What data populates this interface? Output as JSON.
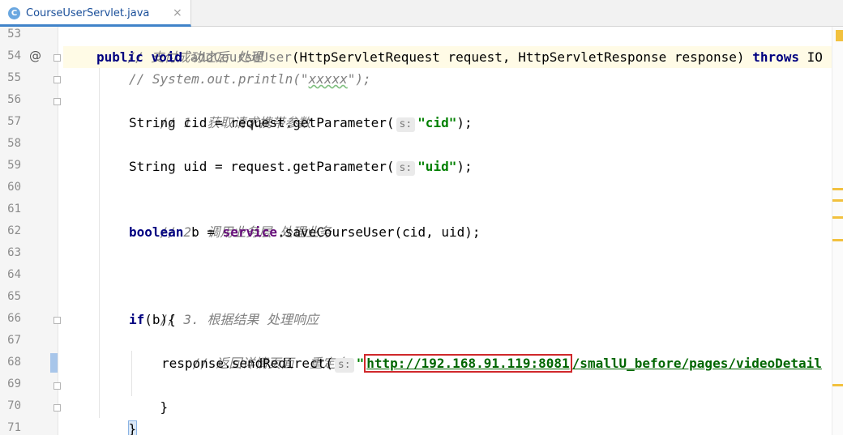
{
  "tab": {
    "icon_letter": "C",
    "file_name": "CourseUserServlet.java",
    "close_glyph": "×"
  },
  "gutter": {
    "line_numbers": [
      "53",
      "54",
      "55",
      "56",
      "57",
      "58",
      "59",
      "60",
      "61",
      "62",
      "63",
      "64",
      "65",
      "66",
      "67",
      "68",
      "69",
      "70",
      "71"
    ],
    "annotation_line_54": "@"
  },
  "code": {
    "l53": {
      "comment": "// 支付成功之后 处理"
    },
    "l54": {
      "kw1": "public",
      "kw2": "void",
      "method": "addCourseUser",
      "params": "(HttpServletRequest request, HttpServletResponse response)",
      "kw3": "throws",
      "rest": "IO"
    },
    "l55": {
      "comment_a": "// System.out.println(\"",
      "comment_typo": "xxxxx",
      "comment_b": "\");"
    },
    "l56": {
      "comment": "// 1. 获取请求携带参数"
    },
    "l57": {
      "pre": "String cid = request.getParameter(",
      "hint": "s:",
      "str": "\"cid\"",
      "post": ");"
    },
    "l59": {
      "pre": "String uid = request.getParameter(",
      "hint": "s:",
      "str": "\"uid\"",
      "post": ");"
    },
    "l61": {
      "comment": "// 2. 调用业务层 处理业务"
    },
    "l62": {
      "kw": "boolean",
      "mid": " b = ",
      "field": "service",
      "post": ".saveCourseUser(cid, uid);"
    },
    "l65": {
      "comment": "// 3. 根据结果 处理响应"
    },
    "l66": {
      "kw": "if",
      "post": "(b){"
    },
    "l67": {
      "comment": "// 返回详情页面  重定向"
    },
    "l68": {
      "pre": "response.sendRedirect(",
      "hint": "s:",
      "quote": "\"",
      "url_boxed": "http://192.168.91.119:8081",
      "url_rest": "/smallU_before/pages/videoDetail"
    },
    "l69": {
      "text": "}"
    },
    "l70": {
      "text": "}"
    }
  },
  "colors": {
    "keyword": "#000080",
    "comment": "#808080",
    "string": "#008000",
    "highlight_box": "#d0282b",
    "caret_line": "#fffbe6"
  }
}
